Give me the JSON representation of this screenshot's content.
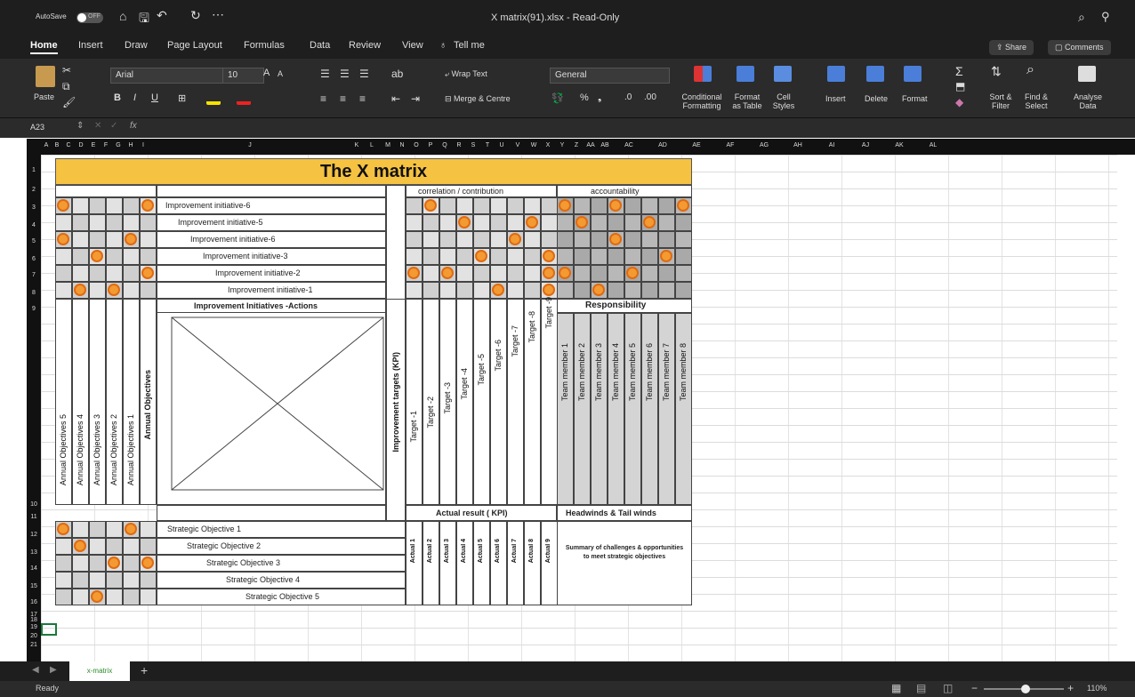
{
  "window": {
    "autosave": "AutoSave",
    "autosave_state": "OFF",
    "title": "X matrix(91).xlsx - Read-Only"
  },
  "ribbon_tabs": [
    "Home",
    "Insert",
    "Draw",
    "Page Layout",
    "Formulas",
    "Data",
    "Review",
    "View",
    "Tell me"
  ],
  "share": "Share",
  "comments": "Comments",
  "ribbon": {
    "paste": "Paste",
    "font": "Arial",
    "size": "10",
    "wrap": "Wrap Text",
    "merge": "Merge & Centre",
    "format": "General",
    "conditional": "Conditional Formatting",
    "format_table": "Format as Table",
    "cell_styles": "Cell Styles",
    "insert": "Insert",
    "delete": "Delete",
    "format_btn": "Format",
    "sort": "Sort & Filter",
    "find": "Find & Select",
    "analyse": "Analyse Data"
  },
  "formula_bar": {
    "cell_ref": "A23",
    "fx": "fx"
  },
  "col_headers": [
    "A",
    "B",
    "C",
    "D",
    "E",
    "F",
    "G",
    "H",
    "I",
    "J",
    "K",
    "L",
    "M",
    "N",
    "O",
    "P",
    "Q",
    "R",
    "S",
    "T",
    "U",
    "V",
    "W",
    "X",
    "Y",
    "Z",
    "AA",
    "AB",
    "AC",
    "AD",
    "AE",
    "AF",
    "AG",
    "AH",
    "AI",
    "AJ",
    "AK",
    "AL"
  ],
  "row_headers": [
    "1",
    "2",
    "3",
    "4",
    "5",
    "6",
    "7",
    "8",
    "9",
    "10",
    "11",
    "12",
    "13",
    "14",
    "15",
    "16",
    "17",
    "18",
    "19",
    "20",
    "21"
  ],
  "matrix": {
    "title": "The X matrix",
    "correlation": "correlation / contribution",
    "accountability": "accountability",
    "initiatives": [
      "Improvement initiative-6",
      "Improvement initiative-5",
      "Improvement initiative-6",
      "Improvement initiative-3",
      "Improvement initiative-2",
      "Improvement initiative-1"
    ],
    "actions_header": "Improvement Initiatives -Actions",
    "responsibility": "Responsibility",
    "annual_objectives": [
      "Annual Objectives 5",
      "Annual Objectives 4",
      "Annual Objectives 3",
      "Annual Objectives 2",
      "Annual Objectives 1"
    ],
    "annual_label": "Annual Objectives",
    "kpi_label": "Improvement targets (KPI)",
    "targets": [
      "Target -1",
      "Target -2",
      "Target -3",
      "Target -4",
      "Target -5",
      "Target -6",
      "Target -7",
      "Target -8",
      "Target -9"
    ],
    "team": [
      "Team member 1",
      "Team member 2",
      "Team member 3",
      "Team member 4",
      "Team member 5",
      "Team member 6",
      "Team member 7",
      "Team member 8"
    ],
    "actual_header": "Actual result ( KPI)",
    "headwinds": "Headwinds & Tail winds",
    "actuals": [
      "Actual 1",
      "Actual 2",
      "Actual 3",
      "Actual 4",
      "Actual 5",
      "Actual 6",
      "Actual 7",
      "Actual 8",
      "Actual 9"
    ],
    "summary": "Summary of challenges & opportunities to meet strategic objectives",
    "strategic": [
      "Strategic Objective 1",
      "Strategic Objective 2",
      "Strategic Objective 3",
      "Strategic Objective 4",
      "Strategic Objective 5"
    ]
  },
  "sheet_tab": "x-matrix",
  "status": {
    "ready": "Ready",
    "zoom": "110%"
  },
  "colors": {
    "accent": "#f5c242",
    "dot": "#f39a33"
  }
}
